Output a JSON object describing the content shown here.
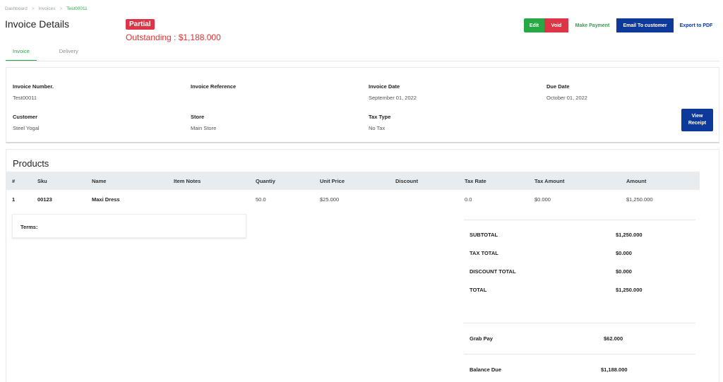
{
  "breadcrumb": {
    "items": [
      "Dashboard",
      "Invoices",
      "Test00011"
    ],
    "separator": ">"
  },
  "header": {
    "title": "Invoice Details",
    "status_badge": "Partial",
    "outstanding": "Outstanding : $1,188.000"
  },
  "actions": {
    "edit": "Edit",
    "void": "Void",
    "make_payment": "Make Payment",
    "email_customer": "Email To customer",
    "export_pdf": "Export to PDF"
  },
  "tabs": [
    {
      "label": "Invoice",
      "active": true
    },
    {
      "label": "Delivery",
      "active": false
    }
  ],
  "info": {
    "invoice_number": {
      "label": "Invoice Number.",
      "value": "Test00011"
    },
    "invoice_reference": {
      "label": "Invoice Reference",
      "value": ""
    },
    "invoice_date": {
      "label": "Invoice Date",
      "value": "September 01, 2022"
    },
    "due_date": {
      "label": "Due Date",
      "value": "October 01, 2022"
    },
    "customer": {
      "label": "Customer",
      "value": "Steel Yogal"
    },
    "store": {
      "label": "Store",
      "value": "Main Store"
    },
    "tax_type": {
      "label": "Tax Type",
      "value": "No Tax"
    },
    "view_receipt_line1": "View",
    "view_receipt_line2": "Receipt"
  },
  "products": {
    "title": "Products",
    "columns": [
      "#",
      "Sku",
      "Name",
      "Item Notes",
      "Quantiy",
      "Unit Price",
      "Discount",
      "Tax Rate",
      "Tax Amount",
      "Amount"
    ],
    "rows": [
      {
        "index": "1",
        "sku": "00123",
        "name": "Maxi Dress",
        "notes": "",
        "quantity": "50.0",
        "unit_price": "$25.000",
        "discount": "",
        "tax_rate": "0.0",
        "tax_amount": "$0.000",
        "amount": "$1,250.000"
      }
    ],
    "terms_label": "Terms:"
  },
  "summary": {
    "subtotal_label": "SUBTOTAL",
    "subtotal": "$1,250.000",
    "tax_total_label": "TAX TOTAL",
    "tax_total": "$0.000",
    "discount_total_label": "DISCOUNT TOTAL",
    "discount_total": "$0.000",
    "total_label": "TOTAL",
    "total": "$1,250.000",
    "payment_label": "Grab Pay",
    "payment": "$62.000",
    "balance_label": "Balance Due",
    "balance": "$1,188.000"
  },
  "colors": {
    "green": "#28a745",
    "red": "#dc3545",
    "navy": "#0d3a9a",
    "table_header_bg": "#e9ecef"
  }
}
